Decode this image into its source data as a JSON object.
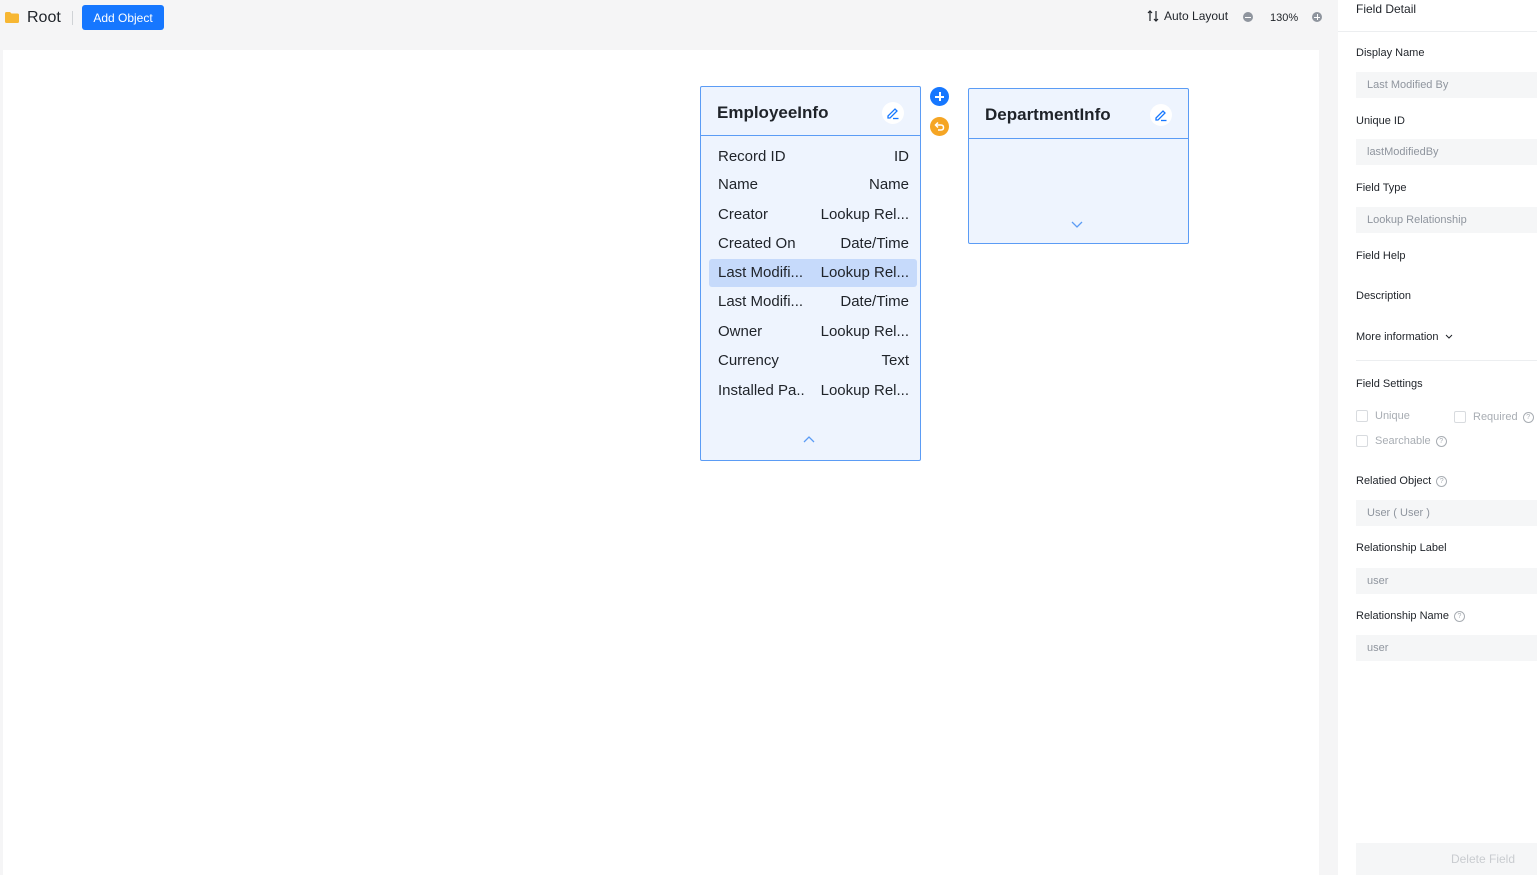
{
  "header": {
    "root_label": "Root",
    "add_object_label": "Add Object",
    "auto_layout_label": "Auto Layout",
    "zoom_level": "130%"
  },
  "objects": [
    {
      "title": "EmployeeInfo",
      "fields": [
        {
          "name": "Record ID",
          "type": "ID",
          "selected": false
        },
        {
          "name": "Name",
          "type": "Name",
          "selected": false
        },
        {
          "name": "Creator",
          "type": "Lookup Rel...",
          "selected": false
        },
        {
          "name": "Created On",
          "type": "Date/Time",
          "selected": false
        },
        {
          "name": "Last Modifi...",
          "type": "Lookup Rel...",
          "selected": true
        },
        {
          "name": "Last Modifi...",
          "type": "Date/Time",
          "selected": false
        },
        {
          "name": "Owner",
          "type": "Lookup Rel...",
          "selected": false
        },
        {
          "name": "Currency",
          "type": "Text",
          "selected": false
        },
        {
          "name": "Installed Pa...",
          "type": "Lookup Rel...",
          "selected": false
        }
      ]
    },
    {
      "title": "DepartmentInfo",
      "fields": []
    }
  ],
  "panel": {
    "title": "Field Detail",
    "display_name_label": "Display Name",
    "display_name_value": "Last Modified By",
    "unique_id_label": "Unique ID",
    "unique_id_value": "lastModifiedBy",
    "field_type_label": "Field Type",
    "field_type_value": "Lookup Relationship",
    "field_help_label": "Field Help",
    "description_label": "Description",
    "more_info_label": "More information",
    "field_settings_label": "Field Settings",
    "unique_label": "Unique",
    "required_label": "Required",
    "searchable_label": "Searchable",
    "related_object_label": "Relatied Object",
    "related_object_value": "User ( User )",
    "relationship_label_label": "Relationship Label",
    "relationship_label_value": "user",
    "relationship_name_label": "Relationship Name",
    "relationship_name_value": "user",
    "delete_label": "Delete Field"
  },
  "colors": {
    "accent": "#1677ff",
    "card_border": "#5b9cf5",
    "card_bg": "#eef4fe",
    "selected_row": "#c6dafb",
    "link_orange": "#f5a524",
    "folder": "#f7b733"
  }
}
